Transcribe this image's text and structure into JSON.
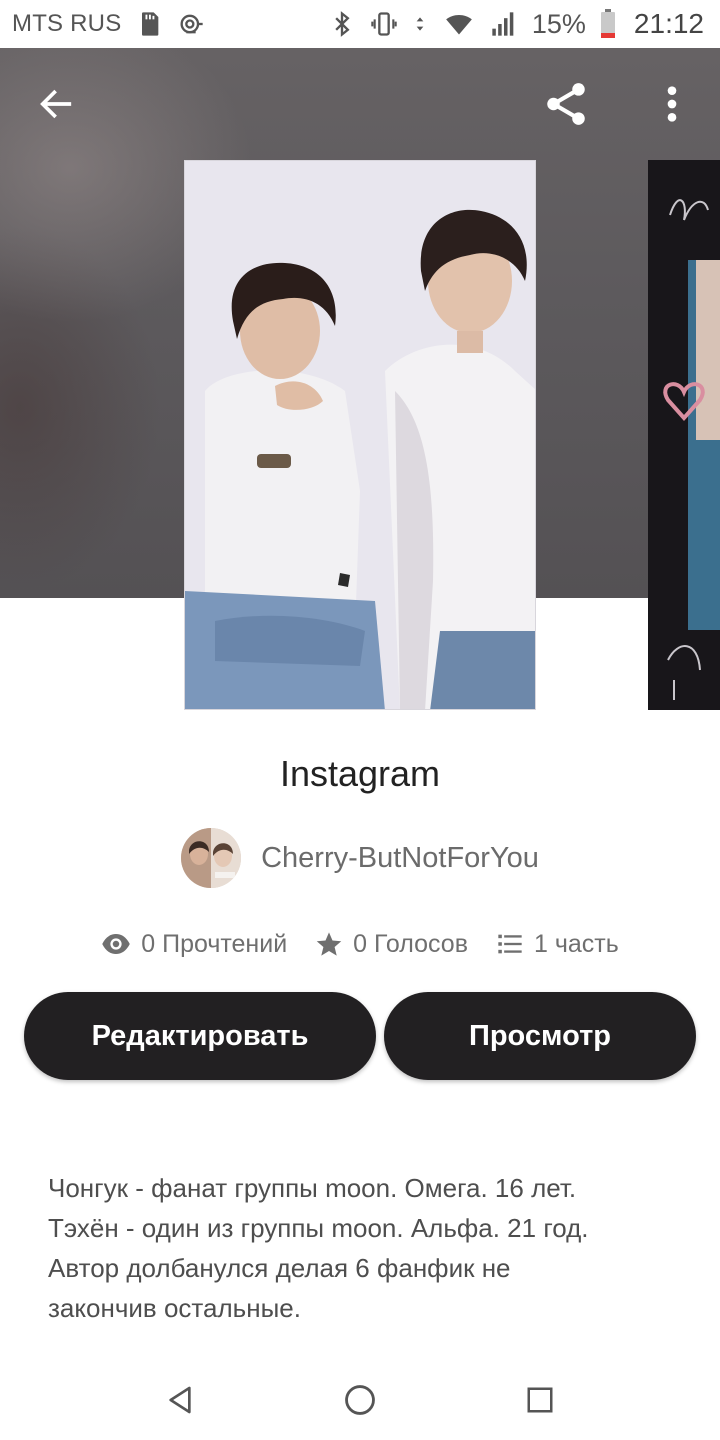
{
  "status_bar": {
    "carrier": "MTS RUS",
    "battery_percent": "15%",
    "time": "21:12",
    "icons": [
      "sd-card-icon",
      "nfc-icon",
      "bluetooth-icon",
      "vibrate-icon",
      "data-arrows-icon",
      "wifi-icon",
      "signal-icon",
      "battery-icon"
    ]
  },
  "header": {
    "icons": [
      "back-arrow-icon",
      "share-icon",
      "more-vert-icon"
    ]
  },
  "story": {
    "title": "Instagram",
    "author": "Cherry-ButNotForYou",
    "stats": {
      "reads": "0 Прочтений",
      "votes": "0 Голосов",
      "parts": "1 часть"
    },
    "stat_icons": [
      "eye-icon",
      "star-icon",
      "list-icon"
    ]
  },
  "actions": {
    "edit_label": "Редактировать",
    "view_label": "Просмотр"
  },
  "description": {
    "lines": [
      "Чонгук - фанат группы moon. Омега. 16 лет.",
      "Тэхён - один из группы moon. Альфа. 21 год.",
      "Автор долбанулся делая 6 фанфик не",
      "закончив остальные."
    ]
  },
  "nav_bar": {
    "icons": [
      "nav-back-icon",
      "nav-home-icon",
      "nav-recents-icon"
    ]
  },
  "colors": {
    "hero_bg": "#5d5a5d",
    "button_bg": "#222022",
    "button_text": "#ffffff",
    "title_text": "#222222",
    "muted_text": "#6f6f6f"
  }
}
